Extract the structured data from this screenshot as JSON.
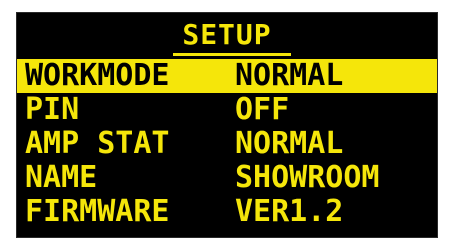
{
  "screen": {
    "title": "SETUP",
    "accent_color": "#f5e60a",
    "background_color": "#000000",
    "selected_index": 0,
    "rows": [
      {
        "label": "WORKMODE",
        "value": "NORMAL"
      },
      {
        "label": "PIN",
        "value": "OFF"
      },
      {
        "label": "AMP STAT",
        "value": "NORMAL"
      },
      {
        "label": "NAME",
        "value": "SHOWROOM"
      },
      {
        "label": "FIRMWARE",
        "value": "VER1.2"
      }
    ]
  }
}
